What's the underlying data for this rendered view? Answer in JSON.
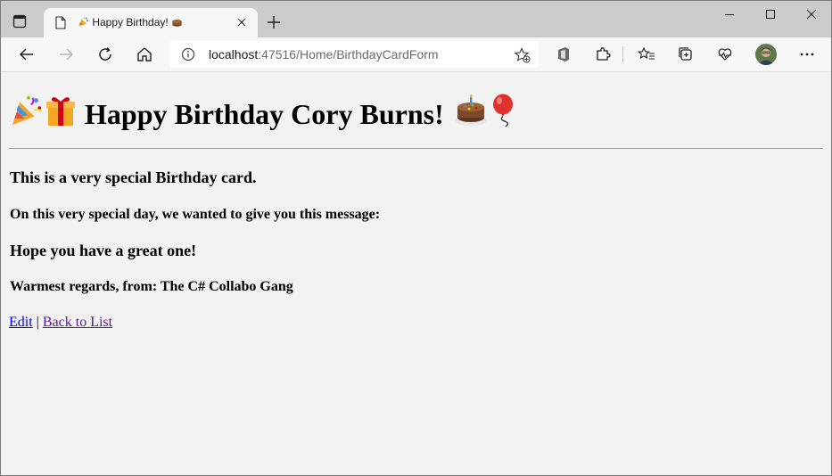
{
  "browser": {
    "tab": {
      "title": "Happy Birthday! "
    },
    "address": {
      "host": "localhost",
      "path": ":47516/Home/BirthdayCardForm"
    }
  },
  "page": {
    "heading": "Happy Birthday Cory Burns!",
    "line1": "This is a very special Birthday card.",
    "line2": "On this very special day, we wanted to give you this message:",
    "message": "Hope you have a great one!",
    "regards": "Warmest regards, from: The C# Collabo Gang",
    "edit_link": "Edit",
    "link_separator": "|",
    "back_link": "Back to List"
  },
  "icons": {
    "heading_leading": [
      "party-popper-icon",
      "gift-icon"
    ],
    "heading_trailing": [
      "cake-icon",
      "balloon-icon"
    ],
    "tab_title_trailing": "cake-icon"
  }
}
